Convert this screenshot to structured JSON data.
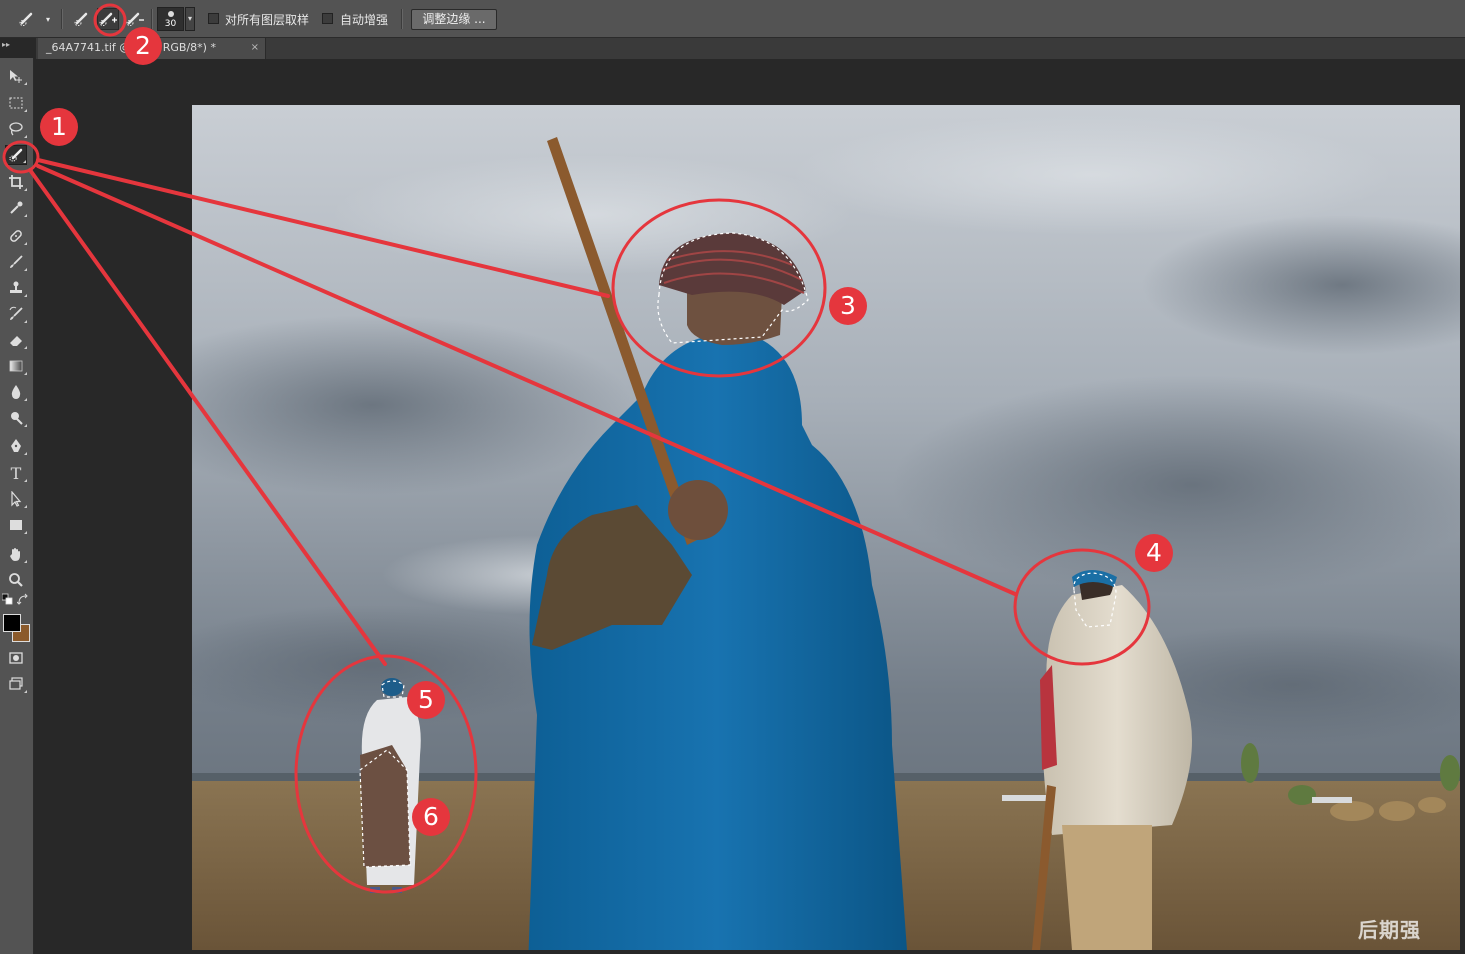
{
  "options_bar": {
    "brush_size": "30",
    "sample_all_layers_label": "对所有图层取样",
    "auto_enhance_label": "自动增强",
    "refine_edge_label": "调整边缘 ..."
  },
  "document_tab": {
    "title": "_64A7741.tif @ 背景, RGB/8*) *",
    "close": "×"
  },
  "watermark": "后期强",
  "annotations": [
    {
      "number": "1"
    },
    {
      "number": "2"
    },
    {
      "number": "3"
    },
    {
      "number": "4"
    },
    {
      "number": "5"
    },
    {
      "number": "6"
    }
  ],
  "colors": {
    "annotation": "#e5363d",
    "foreground": "#000000",
    "background": "#8b5a2b"
  }
}
